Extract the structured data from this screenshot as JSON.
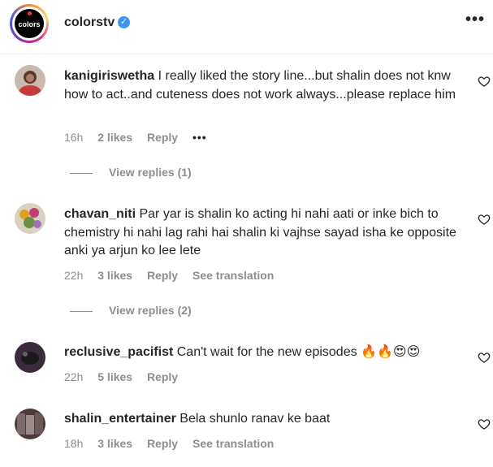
{
  "header": {
    "avatar_text": "colors",
    "handle": "colorstv",
    "verified_icon": "verified-badge-icon",
    "more_icon": "more-horizontal-icon",
    "more_label": "•••"
  },
  "comments": [
    {
      "username": "kanigiriswetha",
      "text": "I really liked the story line...but shalin does not knw how to act..and cuteness does not work always...please replace him",
      "time": "16h",
      "likes": "2 likes",
      "reply": "Reply",
      "extra": "•••",
      "view_replies": "View replies (1)",
      "avatar_color": "#b07a6a"
    },
    {
      "username": "chavan_niti",
      "text": "Par yar is shalin ko acting hi nahi aati or inke bich to chemistry hi nahi lag rahi hai shalin ki vajhse sayad isha ke opposite anki ya arjun ko lee lete",
      "time": "22h",
      "likes": "3 likes",
      "reply": "Reply",
      "extra": "See translation",
      "view_replies": "View replies (2)",
      "avatar_color": "#8aa060"
    },
    {
      "username": "reclusive_pacifist",
      "text": "Can't wait for the new episodes",
      "emojis": "🔥🔥😍😍",
      "time": "22h",
      "likes": "5 likes",
      "reply": "Reply",
      "avatar_color": "#2a2a2a"
    },
    {
      "username": "shalin_entertainer",
      "text": "Bela shunlo ranav ke baat",
      "time": "18h",
      "likes": "3 likes",
      "reply": "Reply",
      "extra": "See translation",
      "avatar_color": "#6a5a5a"
    }
  ],
  "icons": {
    "heart": "heart-outline-icon"
  }
}
